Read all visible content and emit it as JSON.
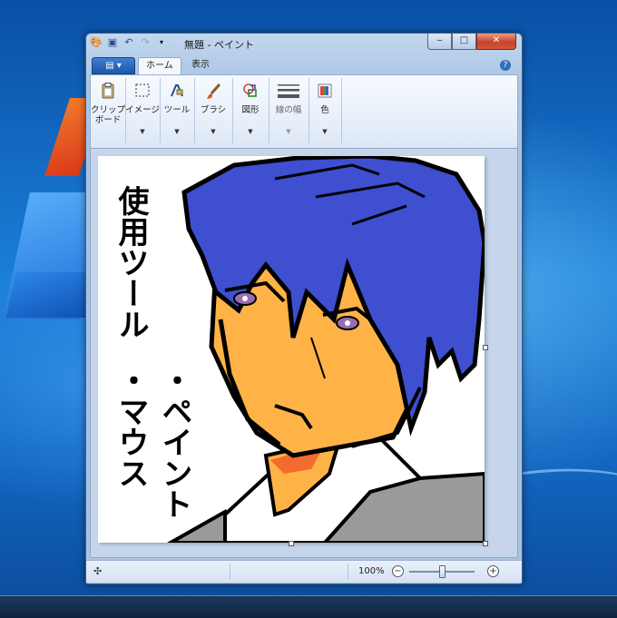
{
  "window": {
    "title": "無題 - ペイント",
    "minimize": "‒",
    "maximize": "□",
    "close": "✕"
  },
  "tabs": {
    "file_menu": "▤ ▾",
    "home": "ホーム",
    "view": "表示"
  },
  "ribbon": {
    "groups": [
      {
        "label": "クリップ\nボード",
        "icon": "clipboard-icon"
      },
      {
        "label": "イメージ",
        "icon": "select-icon"
      },
      {
        "label": "ツール",
        "icon": "tools-icon"
      },
      {
        "label": "ブラシ",
        "icon": "brush-icon"
      },
      {
        "label": "図形",
        "icon": "shapes-icon"
      },
      {
        "label": "線の幅",
        "icon": "line-width-icon"
      },
      {
        "label": "色",
        "icon": "color-icon"
      }
    ]
  },
  "canvas": {
    "text_line1": "使用ツール",
    "text_line2": "・ペイント",
    "text_line3": "・マウス"
  },
  "status": {
    "zoom": "100%",
    "zoom_out": "−",
    "zoom_in": "+",
    "zoom_fraction": 0.5
  },
  "colors": {
    "hair": "#3e4fd0",
    "skin": "#ffb347",
    "shirt": "#ffffff",
    "jacket": "#9a9a9a"
  }
}
